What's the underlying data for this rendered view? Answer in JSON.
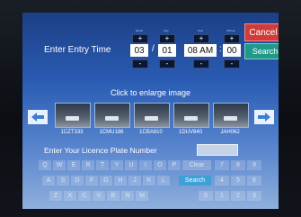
{
  "header": {
    "cancel_label": "Cancel",
    "entry_label": "Enter Entry Time",
    "column_labels": {
      "month": "Month",
      "day": "Day",
      "hour": "Hour",
      "minute": "Minute"
    },
    "plus_symbol": "+",
    "minus_symbol": "-",
    "month": "03",
    "date_separator": "/",
    "day": "01",
    "hour": "08 AM",
    "time_separator": ":",
    "minute": "00",
    "search_label": "Search"
  },
  "images": {
    "instruction": "Click to enlarge image",
    "plates": [
      "1CZT333",
      "1CMU186",
      "1CBA810",
      "1DUV840",
      "JAH062"
    ],
    "left_arrow_icon": "arrow-left-icon",
    "right_arrow_icon": "arrow-right-icon"
  },
  "plate_entry": {
    "label": "Enter Your Licence Plate Number",
    "value": ""
  },
  "keyboard": {
    "row1": [
      "Q",
      "W",
      "E",
      "R",
      "T",
      "Y",
      "U",
      "I",
      "O",
      "P"
    ],
    "clear_label": "Clear",
    "num_row1": [
      "7",
      "8",
      "9"
    ],
    "row2": [
      "A",
      "S",
      "D",
      "F",
      "G",
      "H",
      "J",
      "K",
      "L"
    ],
    "search_label": "Search",
    "num_row2": [
      "4",
      "5",
      "6"
    ],
    "row3": [
      "Z",
      "X",
      "C",
      "V",
      "B",
      "N",
      "M"
    ],
    "num_row3": [
      "0",
      "1",
      "2",
      "3"
    ]
  },
  "colors": {
    "cancel": "#d03b3b",
    "search": "#1f9a8a",
    "screen_top": "#1c3f86",
    "screen_bottom": "#8fb0dd"
  }
}
